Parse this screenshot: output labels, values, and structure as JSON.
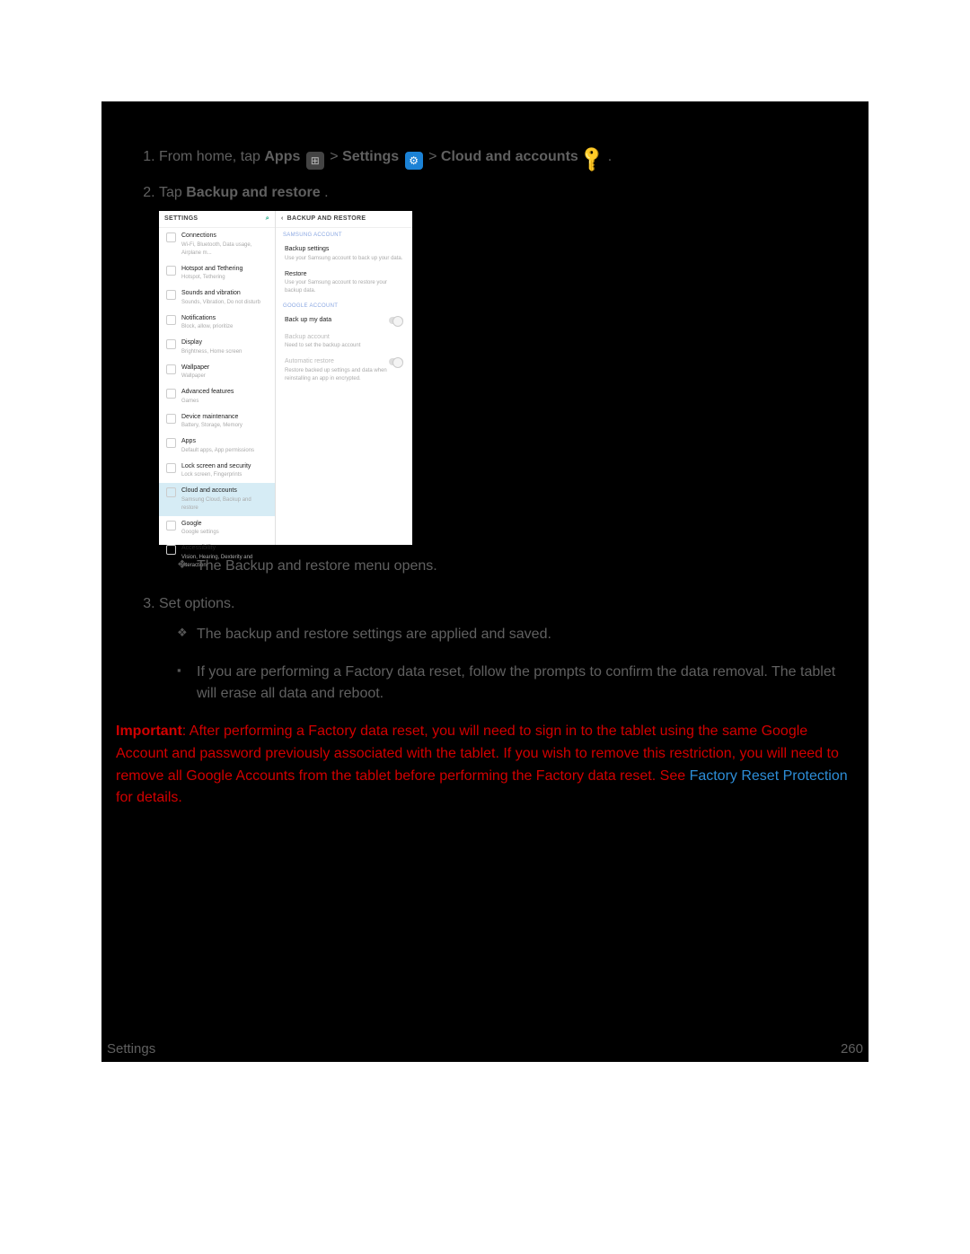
{
  "steps": {
    "one": {
      "prefix": "From home, tap ",
      "apps": "Apps",
      "sep1": " > ",
      "settings": "Settings",
      "sep2": " > ",
      "cloud": "Cloud and accounts",
      "end": "."
    },
    "two": {
      "prefix": "Tap ",
      "bold": "Backup and restore",
      "end": "."
    },
    "two_result": "The Backup and restore menu opens.",
    "three": "Set options.",
    "three_r1": "The backup and restore settings are applied and saved.",
    "three_r2": "If you are performing a Factory data reset, follow the prompts to confirm the data removal. The tablet will erase all data and reboot."
  },
  "important": {
    "lead": "Important",
    "colon": ": ",
    "body": "After performing a Factory data reset, you will need to sign in to the tablet using the same Google Account and password previously associated with the tablet. If you wish to remove this restriction, you will need to remove all Google Accounts from the tablet before performing the Factory data reset. See ",
    "link": "Factory Reset Protection",
    "tail": " for details."
  },
  "footer": {
    "left": "Settings",
    "right": "260"
  },
  "shot": {
    "left_title": "SETTINGS",
    "right_title": "BACKUP AND RESTORE",
    "left_items": [
      {
        "t": "Connections",
        "s": "Wi-Fi, Bluetooth, Data usage, Airplane m..."
      },
      {
        "t": "Hotspot and Tethering",
        "s": "Hotspot, Tethering"
      },
      {
        "t": "Sounds and vibration",
        "s": "Sounds, Vibration, Do not disturb"
      },
      {
        "t": "Notifications",
        "s": "Block, allow, prioritize"
      },
      {
        "t": "Display",
        "s": "Brightness, Home screen"
      },
      {
        "t": "Wallpaper",
        "s": "Wallpaper"
      },
      {
        "t": "Advanced features",
        "s": "Games"
      },
      {
        "t": "Device maintenance",
        "s": "Battery, Storage, Memory"
      },
      {
        "t": "Apps",
        "s": "Default apps, App permissions"
      },
      {
        "t": "Lock screen and security",
        "s": "Lock screen, Fingerprints"
      },
      {
        "t": "Cloud and accounts",
        "s": "Samsung Cloud, Backup and restore",
        "sel": true
      },
      {
        "t": "Google",
        "s": "Google settings"
      },
      {
        "t": "Accessibility",
        "s": "Vision, Hearing, Dexterity and interaction"
      }
    ],
    "sec_samsung": "SAMSUNG ACCOUNT",
    "r_backup_settings": {
      "t": "Backup settings",
      "s": "Use your Samsung account to back up your data."
    },
    "r_restore": {
      "t": "Restore",
      "s": "Use your Samsung account to restore your backup data."
    },
    "sec_google": "GOOGLE ACCOUNT",
    "r_backup_my_data": {
      "t": "Back up my data"
    },
    "r_backup_account": {
      "t": "Backup account",
      "s": "Need to set the backup account"
    },
    "r_auto_restore": {
      "t": "Automatic restore",
      "s": "Restore backed up settings and data when reinstalling an app in encrypted."
    }
  }
}
